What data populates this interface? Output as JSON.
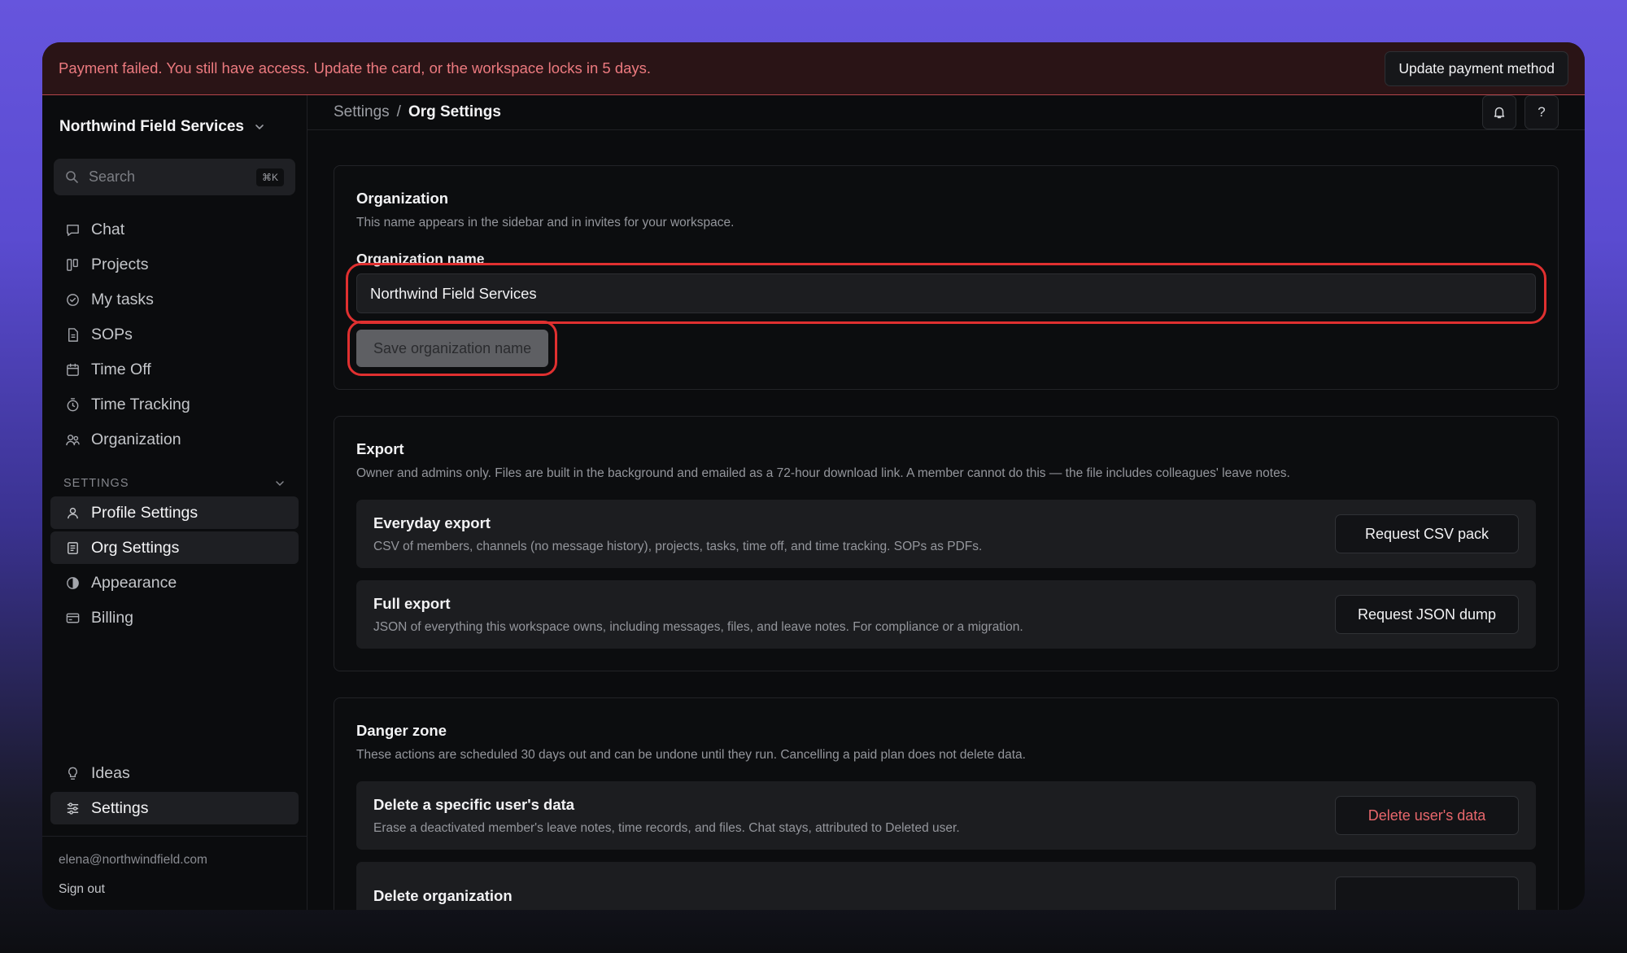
{
  "banner": {
    "message": "Payment failed. You still have access. Update the card, or the workspace locks in 5 days.",
    "action_label": "Update payment method"
  },
  "sidebar": {
    "org_name": "Northwind Field Services",
    "search": {
      "placeholder": "Search",
      "shortcut": "⌘K"
    },
    "nav_items": [
      {
        "label": "Chat",
        "icon": "chat-icon"
      },
      {
        "label": "Projects",
        "icon": "kanban-icon"
      },
      {
        "label": "My tasks",
        "icon": "check-circle-icon"
      },
      {
        "label": "SOPs",
        "icon": "document-icon"
      },
      {
        "label": "Time Off",
        "icon": "calendar-icon"
      },
      {
        "label": "Time Tracking",
        "icon": "stopwatch-icon"
      },
      {
        "label": "Organization",
        "icon": "people-icon"
      }
    ],
    "settings_section": {
      "label": "SETTINGS",
      "items": [
        {
          "label": "Profile Settings",
          "icon": "user-icon"
        },
        {
          "label": "Org Settings",
          "icon": "org-doc-icon",
          "active": true
        },
        {
          "label": "Appearance",
          "icon": "contrast-icon"
        },
        {
          "label": "Billing",
          "icon": "card-icon"
        }
      ]
    },
    "bottom_items": [
      {
        "label": "Ideas",
        "icon": "lightbulb-icon"
      },
      {
        "label": "Settings",
        "icon": "sliders-icon",
        "active": true
      }
    ],
    "user_email": "elena@northwindfield.com",
    "signout_label": "Sign out"
  },
  "topbar": {
    "breadcrumb_root": "Settings",
    "breadcrumb_separator": "/",
    "breadcrumb_current": "Org Settings",
    "help_label": "?"
  },
  "organization_card": {
    "title": "Organization",
    "description": "This name appears in the sidebar and in invites for your workspace.",
    "field_label": "Organization name",
    "field_value": "Northwind Field Services",
    "save_label": "Save organization name"
  },
  "export_card": {
    "title": "Export",
    "description": "Owner and admins only. Files are built in the background and emailed as a 72-hour download link. A member cannot do this — the file includes colleagues' leave notes.",
    "rows": [
      {
        "title": "Everyday export",
        "description": "CSV of members, channels (no message history), projects, tasks, time off, and time tracking. SOPs as PDFs.",
        "action": "Request CSV pack"
      },
      {
        "title": "Full export",
        "description": "JSON of everything this workspace owns, including messages, files, and leave notes. For compliance or a migration.",
        "action": "Request JSON dump"
      }
    ]
  },
  "danger_card": {
    "title": "Danger zone",
    "description": "These actions are scheduled 30 days out and can be undone until they run. Cancelling a paid plan does not delete data.",
    "rows": [
      {
        "title": "Delete a specific user's data",
        "description": "Erase a deactivated member's leave notes, time records, and files. Chat stays, attributed to Deleted user.",
        "action": "Delete user's data"
      },
      {
        "title": "Delete organization"
      }
    ]
  },
  "colors": {
    "banner_text": "#ec7a7f",
    "highlight_outline": "#e03030",
    "danger_text": "#e8676c"
  }
}
